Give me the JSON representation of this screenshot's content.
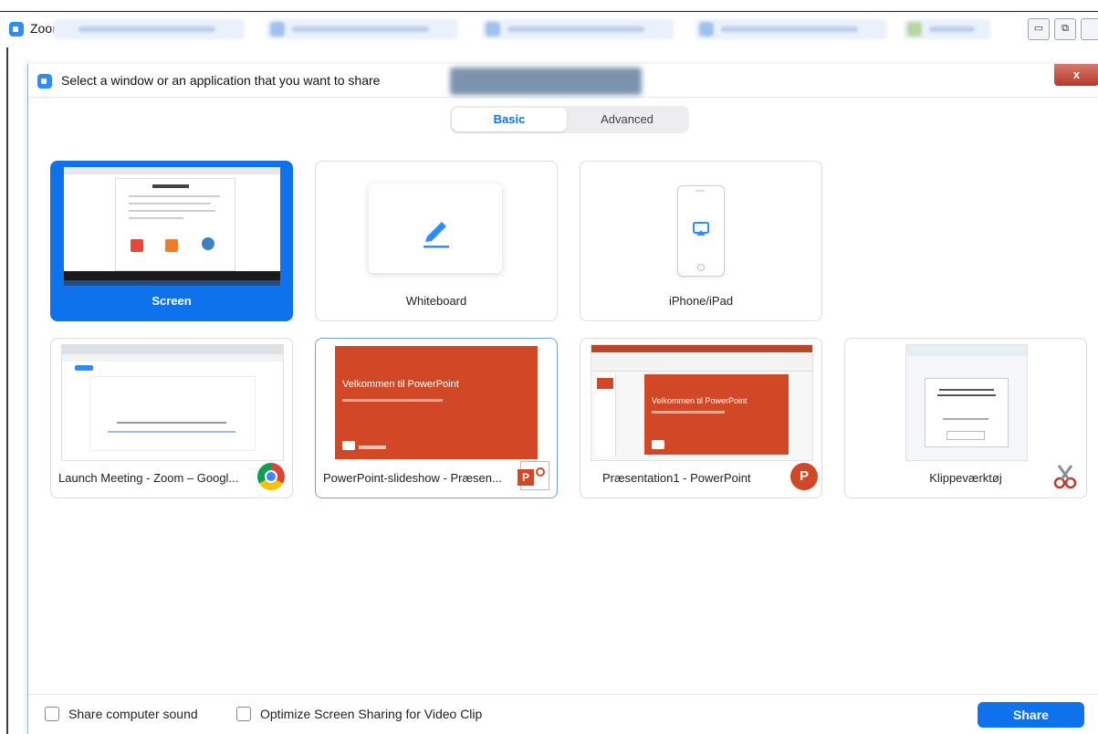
{
  "app": {
    "title": "Zoom"
  },
  "window_controls": {
    "minimize": "▭",
    "restore": "⧉"
  },
  "dialog": {
    "title": "Select a window or an application that you want to share",
    "close": "x"
  },
  "tabs": [
    {
      "label": "Basic",
      "active": true
    },
    {
      "label": "Advanced",
      "active": false
    }
  ],
  "basic_items": [
    {
      "label": "Screen",
      "selected": true
    },
    {
      "label": "Whiteboard",
      "selected": false
    },
    {
      "label": "iPhone/iPad",
      "selected": false
    }
  ],
  "windows": [
    {
      "label": "Launch Meeting - Zoom – Googl...",
      "icon": "chrome-icon"
    },
    {
      "label": "PowerPoint-slideshow  -  Præsen...",
      "icon": "powerpoint-doc-icon",
      "slide_title": "Velkommen til PowerPoint"
    },
    {
      "label": "Præsentation1 - PowerPoint",
      "icon": "powerpoint-icon",
      "slide_title": "Velkommen til PowerPoint"
    },
    {
      "label": "Klippeværktøj",
      "icon": "snipping-tool-icon"
    }
  ],
  "footer": {
    "share_sound": "Share computer sound",
    "optimize": "Optimize Screen Sharing for Video Clip",
    "share_button": "Share"
  },
  "colors": {
    "accent": "#0e72ed",
    "zoom_blue": "#2D8CFF",
    "powerpoint": "#d24726"
  }
}
